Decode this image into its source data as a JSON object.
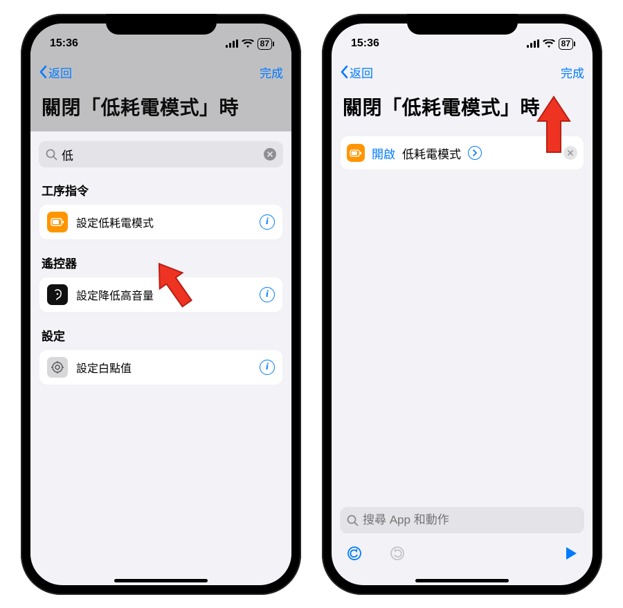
{
  "status": {
    "time": "15:36",
    "battery": "87"
  },
  "nav": {
    "back": "返回",
    "done": "完成"
  },
  "title": "關閉「低耗電模式」時",
  "left": {
    "search_value": "低",
    "sections": [
      {
        "label": "工序指令",
        "item": "設定低耗電模式",
        "icon": "battery-icon",
        "icon_class": "icon-orange"
      },
      {
        "label": "遙控器",
        "item": "設定降低高音量",
        "icon": "ear-icon",
        "icon_class": "icon-black"
      },
      {
        "label": "設定",
        "item": "設定白點值",
        "icon": "settings-icon",
        "icon_class": "icon-gray"
      }
    ]
  },
  "right": {
    "action": {
      "open": "開啟",
      "target": "低耗電模式"
    },
    "search_placeholder": "搜尋 App 和動作"
  }
}
